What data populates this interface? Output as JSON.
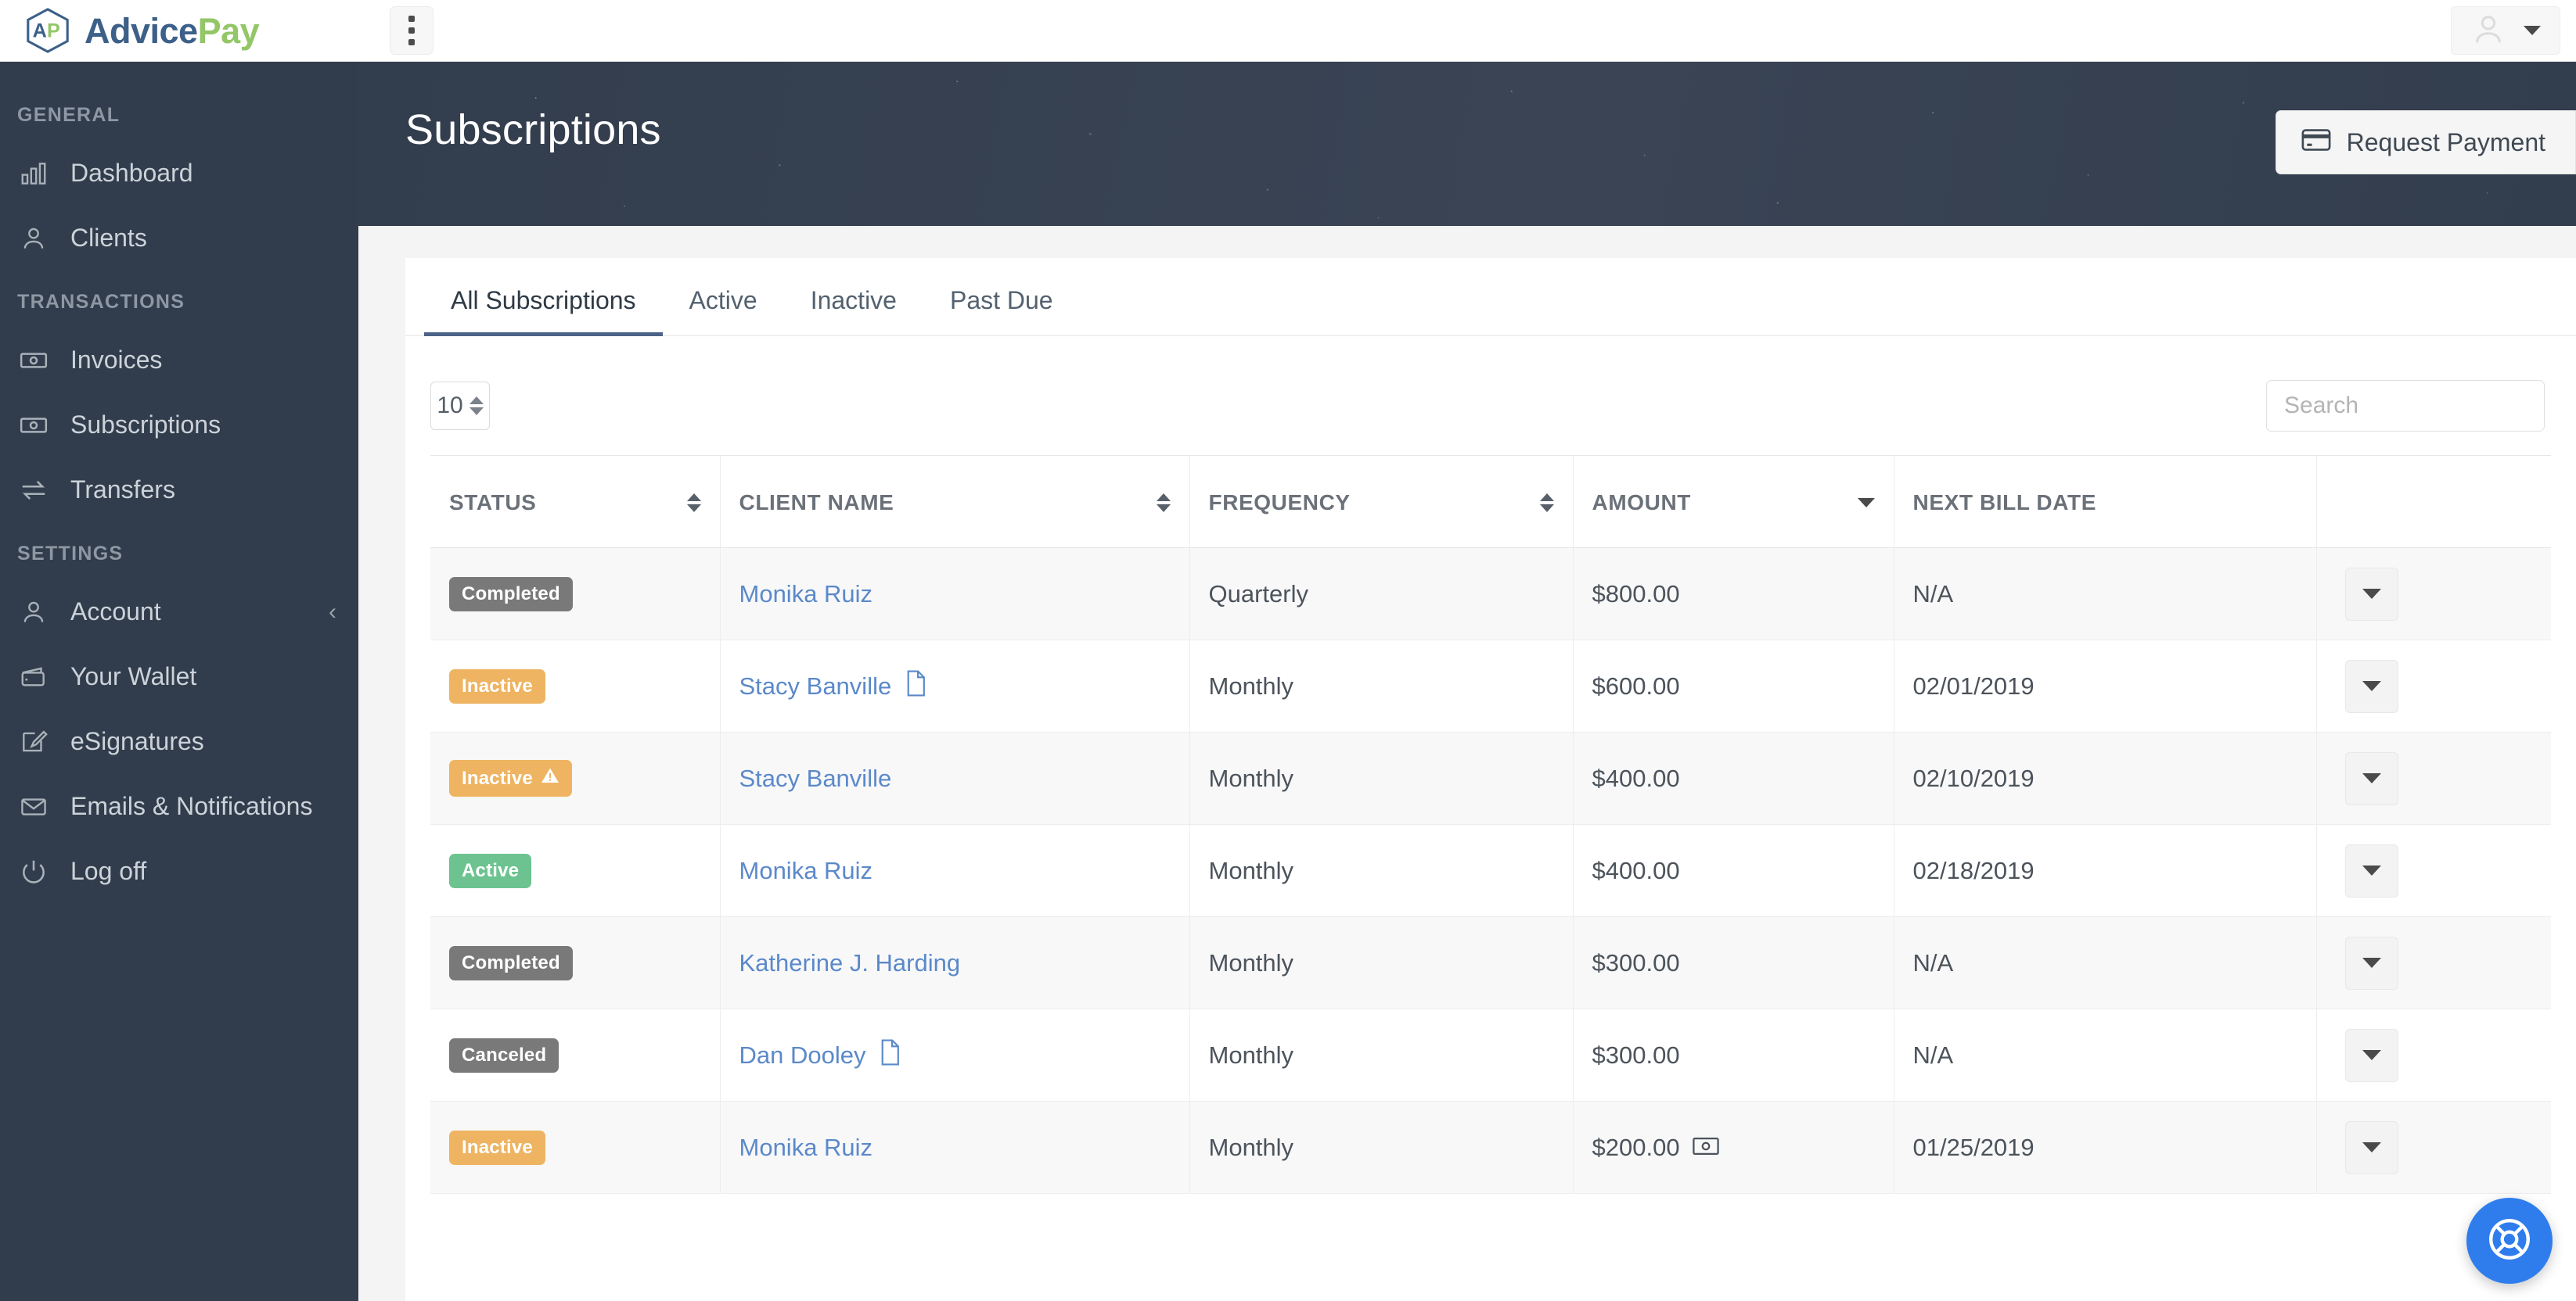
{
  "brand": {
    "advice": "Advice",
    "pay": "Pay",
    "mark_label": "AP"
  },
  "topbar": {
    "kebab_label": "Menu",
    "user_menu_label": "Account menu"
  },
  "sidebar": {
    "groups": [
      {
        "label": "GENERAL",
        "items": [
          {
            "label": "Dashboard",
            "icon": "bar-chart-icon",
            "chevron": ""
          },
          {
            "label": "Clients",
            "icon": "user-icon",
            "chevron": ""
          }
        ]
      },
      {
        "label": "TRANSACTIONS",
        "items": [
          {
            "label": "Invoices",
            "icon": "money-bill-icon",
            "chevron": ""
          },
          {
            "label": "Subscriptions",
            "icon": "money-bill-icon",
            "chevron": ""
          },
          {
            "label": "Transfers",
            "icon": "exchange-icon",
            "chevron": ""
          }
        ]
      },
      {
        "label": "SETTINGS",
        "items": [
          {
            "label": "Account",
            "icon": "user-icon",
            "chevron": "‹"
          },
          {
            "label": "Your Wallet",
            "icon": "wallet-icon",
            "chevron": ""
          },
          {
            "label": "eSignatures",
            "icon": "signature-icon",
            "chevron": ""
          },
          {
            "label": "Emails & Notifications",
            "icon": "envelope-icon",
            "chevron": ""
          },
          {
            "label": "Log off",
            "icon": "power-icon",
            "chevron": ""
          }
        ]
      }
    ]
  },
  "header": {
    "title": "Subscriptions",
    "request_payment_label": "Request Payment",
    "request_payment_icon": "credit-card-icon"
  },
  "tabs": [
    {
      "label": "All Subscriptions",
      "active": true
    },
    {
      "label": "Active",
      "active": false
    },
    {
      "label": "Inactive",
      "active": false
    },
    {
      "label": "Past Due",
      "active": false
    }
  ],
  "controls": {
    "page_size_value": "10",
    "search_placeholder": "Search",
    "search_value": ""
  },
  "table": {
    "columns": [
      {
        "label": "STATUS",
        "sort": "both"
      },
      {
        "label": "CLIENT NAME",
        "sort": "both"
      },
      {
        "label": "FREQUENCY",
        "sort": "both"
      },
      {
        "label": "AMOUNT",
        "sort": "desc"
      },
      {
        "label": "NEXT BILL DATE",
        "sort": "none"
      },
      {
        "label": "",
        "sort": "none"
      }
    ],
    "rows": [
      {
        "status": "Completed",
        "status_color": "gray",
        "status_warn": false,
        "client": "Monika Ruiz",
        "client_doc": false,
        "frequency": "Quarterly",
        "amount": "$800.00",
        "amount_cash": false,
        "next_bill_date": "N/A"
      },
      {
        "status": "Inactive",
        "status_color": "orange",
        "status_warn": false,
        "client": "Stacy Banville",
        "client_doc": true,
        "frequency": "Monthly",
        "amount": "$600.00",
        "amount_cash": false,
        "next_bill_date": "02/01/2019"
      },
      {
        "status": "Inactive",
        "status_color": "orange",
        "status_warn": true,
        "client": "Stacy Banville",
        "client_doc": false,
        "frequency": "Monthly",
        "amount": "$400.00",
        "amount_cash": false,
        "next_bill_date": "02/10/2019"
      },
      {
        "status": "Active",
        "status_color": "green",
        "status_warn": false,
        "client": "Monika Ruiz",
        "client_doc": false,
        "frequency": "Monthly",
        "amount": "$400.00",
        "amount_cash": false,
        "next_bill_date": "02/18/2019"
      },
      {
        "status": "Completed",
        "status_color": "gray",
        "status_warn": false,
        "client": "Katherine J. Harding",
        "client_doc": false,
        "frequency": "Monthly",
        "amount": "$300.00",
        "amount_cash": false,
        "next_bill_date": "N/A"
      },
      {
        "status": "Canceled",
        "status_color": "gray",
        "status_warn": false,
        "client": "Dan Dooley",
        "client_doc": true,
        "frequency": "Monthly",
        "amount": "$300.00",
        "amount_cash": false,
        "next_bill_date": "N/A"
      },
      {
        "status": "Inactive",
        "status_color": "orange",
        "status_warn": false,
        "client": "Monika Ruiz",
        "client_doc": false,
        "frequency": "Monthly",
        "amount": "$200.00",
        "amount_cash": true,
        "next_bill_date": "01/25/2019"
      }
    ]
  },
  "support": {
    "label": "Support",
    "icon": "lifebuoy-icon"
  },
  "colors": {
    "sidebar_bg": "#313d4c",
    "header_bg": "#3a4455",
    "accent_blue": "#5b89c9",
    "badge_gray": "#797979",
    "badge_orange": "#eeb462",
    "badge_green": "#6cc390",
    "tab_underline": "#4b6485",
    "support_blue": "#2f7ded",
    "brand_blue": "#3d6089",
    "brand_green": "#93c667"
  }
}
